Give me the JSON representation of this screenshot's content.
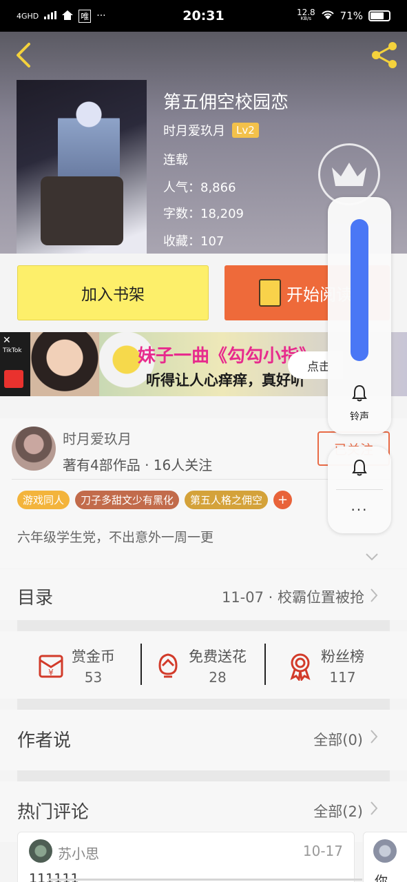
{
  "status_bar": {
    "network": "4GHD",
    "app_badge": "唯",
    "more": "···",
    "time": "20:31",
    "speed": "12.8",
    "speed_unit": "KB/s",
    "battery": "71%"
  },
  "book": {
    "title": "第五佣空校园恋",
    "author": "时月爱玖月",
    "author_level": "Lv2",
    "status": "连载",
    "popularity": "人气：8,866",
    "word_count": "字数：18,209",
    "favorites": "收藏：107"
  },
  "actions": {
    "add_to_shelf": "加入书架",
    "start_reading": "开始阅读"
  },
  "ad": {
    "line1": "妹子一曲《勾勾小指》",
    "line2": "听得让人心痒痒，真好听",
    "click_label": "点击",
    "tiktok_label": "TikTok"
  },
  "author": {
    "name": "时月爱玖月",
    "works": "著有4部作品 · 16人关注",
    "follow_label": "已关注"
  },
  "tags": [
    {
      "label": "游戏同人",
      "color": "#f3b43c"
    },
    {
      "label": "刀子多甜文少有黑化",
      "color": "#c26b4b"
    },
    {
      "label": "第五人格之佣空",
      "color": "#d4a23a"
    }
  ],
  "tag_add": "+",
  "description": "六年级学生党，不出意外一周一更",
  "catalog": {
    "label": "目录",
    "latest": "11-07 · 校霸位置被抢"
  },
  "stats": [
    {
      "name": "赏金币",
      "value": "53",
      "icon": "red-envelope-icon"
    },
    {
      "name": "免费送花",
      "value": "28",
      "icon": "flower-icon"
    },
    {
      "name": "粉丝榜",
      "value": "117",
      "icon": "medal-icon"
    }
  ],
  "author_says": {
    "label": "作者说",
    "all": "全部(0)"
  },
  "hot_comments": {
    "label": "热门评论",
    "all": "全部(2)",
    "items": [
      {
        "user": "苏小思",
        "date": "10-17",
        "text": "111111"
      },
      {
        "text": "你"
      }
    ]
  },
  "volume": {
    "label": "铃声",
    "more": "···"
  },
  "colors": {
    "accent_orange": "#ee6a3a",
    "shelf_yellow": "#fdef6a",
    "volume_blue": "#4a77f5"
  }
}
